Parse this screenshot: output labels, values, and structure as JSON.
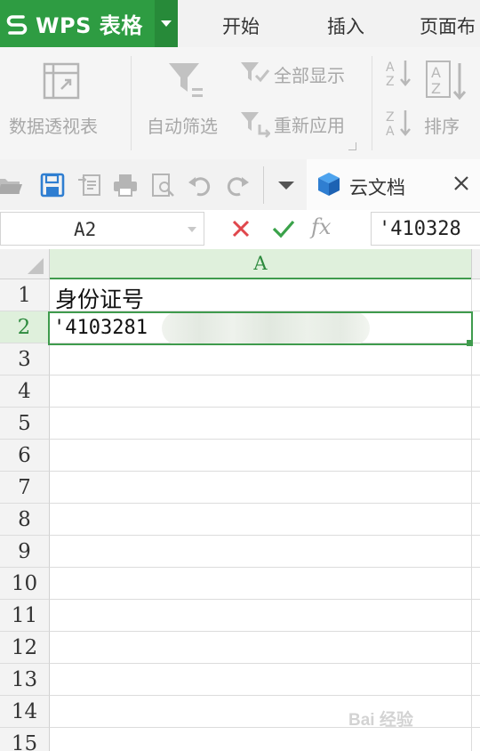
{
  "app": {
    "name": "WPS 表格",
    "brand_color": "#2e9c42"
  },
  "menu": {
    "tabs": [
      "开始",
      "插入",
      "页面布"
    ]
  },
  "ribbon": {
    "pivot_label": "数据透视表",
    "autofilter_label": "自动筛选",
    "show_all_label": "全部显示",
    "reapply_label": "重新应用",
    "sort_label": "排序"
  },
  "quick_access": {
    "icons": [
      "open-folder-icon",
      "save-icon",
      "export-icon",
      "print-icon",
      "print-preview-icon",
      "undo-icon",
      "redo-icon",
      "more-dropdown-icon"
    ],
    "doc_tab_title": "云文档",
    "doc_tab_icon": "cloud-doc-cube-icon"
  },
  "formula_bar": {
    "cell_ref": "A2",
    "fx_label": "fx",
    "value": "'410328"
  },
  "sheet": {
    "column_headers": [
      "A"
    ],
    "row_numbers": [
      "1",
      "2",
      "3",
      "4",
      "5",
      "6",
      "7",
      "8",
      "9",
      "10",
      "11",
      "12",
      "13",
      "14",
      "15"
    ],
    "active_row": "2",
    "a1": "身份证号",
    "a2": "'4103281",
    "selected_cell": "A2"
  },
  "watermark": {
    "text": "Bai 经验"
  }
}
